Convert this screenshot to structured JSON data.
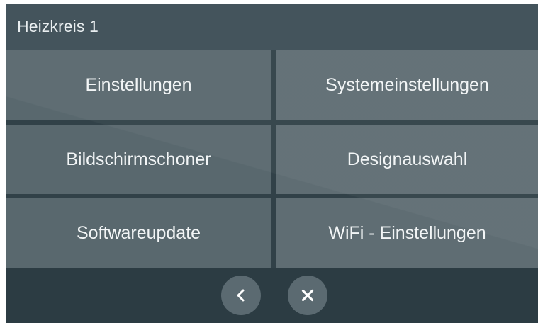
{
  "header": {
    "title": "Heizkreis 1"
  },
  "menu": {
    "items": [
      {
        "label": "Einstellungen",
        "name": "einstellungen-button"
      },
      {
        "label": "Systemeinstellungen",
        "name": "systemeinstellungen-button"
      },
      {
        "label": "Bildschirmschoner",
        "name": "bildschirmschoner-button"
      },
      {
        "label": "Designauswahl",
        "name": "designauswahl-button"
      },
      {
        "label": "Softwareupdate",
        "name": "softwareupdate-button"
      },
      {
        "label": "WiFi - Einstellungen",
        "name": "wifi-einstellungen-button"
      }
    ]
  },
  "footer": {
    "back_icon": "chevron-left-icon",
    "close_icon": "close-icon"
  },
  "colors": {
    "background": "#314148",
    "header": "#3d4e56",
    "tile": "#59686e",
    "footer": "#2c3c43",
    "round_button": "#5b6a71",
    "text": "#f2f5f6"
  }
}
